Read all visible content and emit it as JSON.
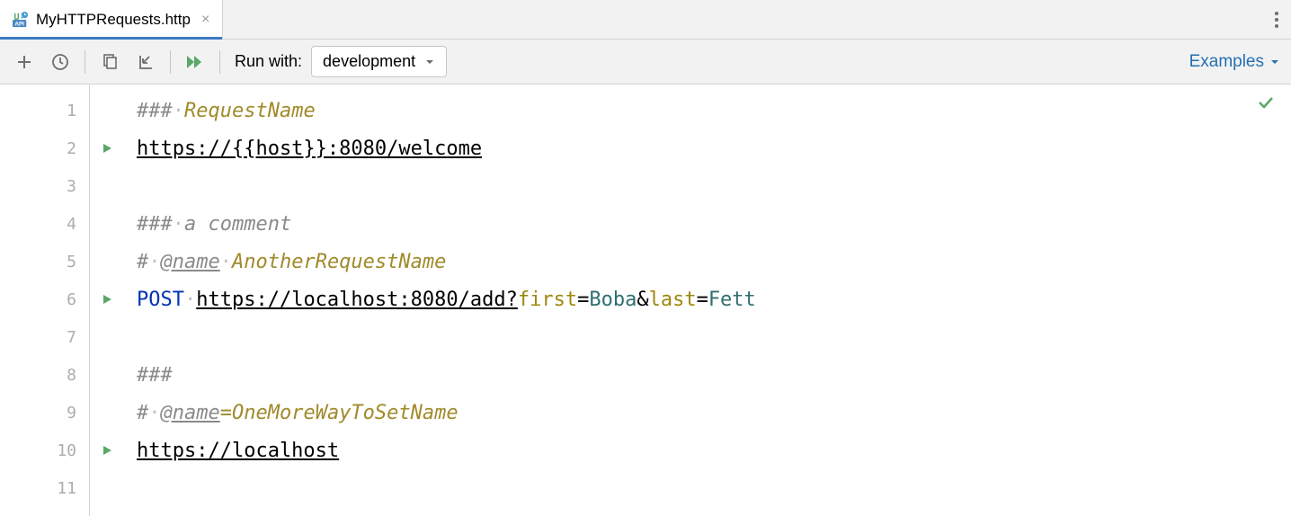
{
  "tab": {
    "title": "MyHTTPRequests.http"
  },
  "toolbar": {
    "run_with_label": "Run with:",
    "env_selected": "development",
    "examples_label": "Examples"
  },
  "editor": {
    "lines": [
      {
        "num": "1"
      },
      {
        "num": "2",
        "runnable": true
      },
      {
        "num": "3"
      },
      {
        "num": "4"
      },
      {
        "num": "5"
      },
      {
        "num": "6",
        "runnable": true
      },
      {
        "num": "7"
      },
      {
        "num": "8"
      },
      {
        "num": "9"
      },
      {
        "num": "10",
        "runnable": true
      },
      {
        "num": "11"
      }
    ],
    "l1": {
      "hash": "### ",
      "name": "RequestName"
    },
    "l2": {
      "url": "https://{{host}}:8080/welcome"
    },
    "l4": {
      "hash": "### ",
      "text": "a comment"
    },
    "l5": {
      "hash": "# ",
      "kw": "@name",
      "name": "AnotherRequestName"
    },
    "l6": {
      "method": "POST",
      "url": "https://localhost:8080/add?",
      "p1": "first",
      "v1": "Boba",
      "amp": "&",
      "p2": "last",
      "v2": "Fett"
    },
    "l8": {
      "hash": "###"
    },
    "l9": {
      "hash": "# ",
      "kw": "@name",
      "eq": "=",
      "name": "OneMoreWayToSetName"
    },
    "l10": {
      "url": "https://localhost"
    }
  }
}
